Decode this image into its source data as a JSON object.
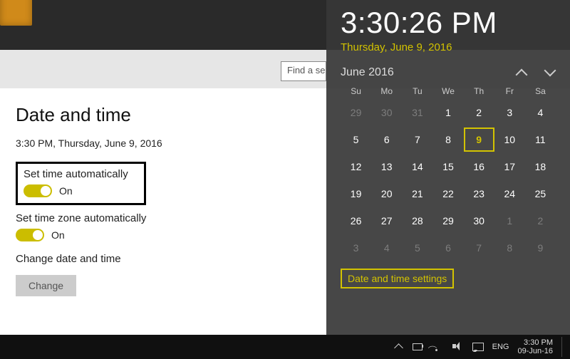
{
  "search": {
    "placeholder": "Find a se"
  },
  "settings": {
    "heading": "Date and time",
    "now": "3:30 PM, Thursday, June 9, 2016",
    "auto_time": {
      "label": "Set time automatically",
      "state": "On"
    },
    "auto_tz": {
      "label": "Set time zone automatically",
      "state": "On"
    },
    "change": {
      "label": "Change date and time",
      "button": "Change"
    }
  },
  "flyout": {
    "time": "3:30:26 PM",
    "date": "Thursday, June 9, 2016",
    "month": "June 2016",
    "dow": [
      "Su",
      "Mo",
      "Tu",
      "We",
      "Th",
      "Fr",
      "Sa"
    ],
    "cells": [
      {
        "n": "29",
        "out": true
      },
      {
        "n": "30",
        "out": true
      },
      {
        "n": "31",
        "out": true
      },
      {
        "n": "1"
      },
      {
        "n": "2"
      },
      {
        "n": "3"
      },
      {
        "n": "4"
      },
      {
        "n": "5"
      },
      {
        "n": "6"
      },
      {
        "n": "7"
      },
      {
        "n": "8"
      },
      {
        "n": "9",
        "today": true
      },
      {
        "n": "10"
      },
      {
        "n": "11"
      },
      {
        "n": "12"
      },
      {
        "n": "13"
      },
      {
        "n": "14"
      },
      {
        "n": "15"
      },
      {
        "n": "16"
      },
      {
        "n": "17"
      },
      {
        "n": "18"
      },
      {
        "n": "19"
      },
      {
        "n": "20"
      },
      {
        "n": "21"
      },
      {
        "n": "22"
      },
      {
        "n": "23"
      },
      {
        "n": "24"
      },
      {
        "n": "25"
      },
      {
        "n": "26"
      },
      {
        "n": "27"
      },
      {
        "n": "28"
      },
      {
        "n": "29"
      },
      {
        "n": "30"
      },
      {
        "n": "1",
        "out": true
      },
      {
        "n": "2",
        "out": true
      },
      {
        "n": "3",
        "out": true
      },
      {
        "n": "4",
        "out": true
      },
      {
        "n": "5",
        "out": true
      },
      {
        "n": "6",
        "out": true
      },
      {
        "n": "7",
        "out": true
      },
      {
        "n": "8",
        "out": true
      },
      {
        "n": "9",
        "out": true
      }
    ],
    "link": "Date and time settings"
  },
  "taskbar": {
    "lang": "ENG",
    "time": "3:30 PM",
    "date": "09-Jun-16"
  }
}
